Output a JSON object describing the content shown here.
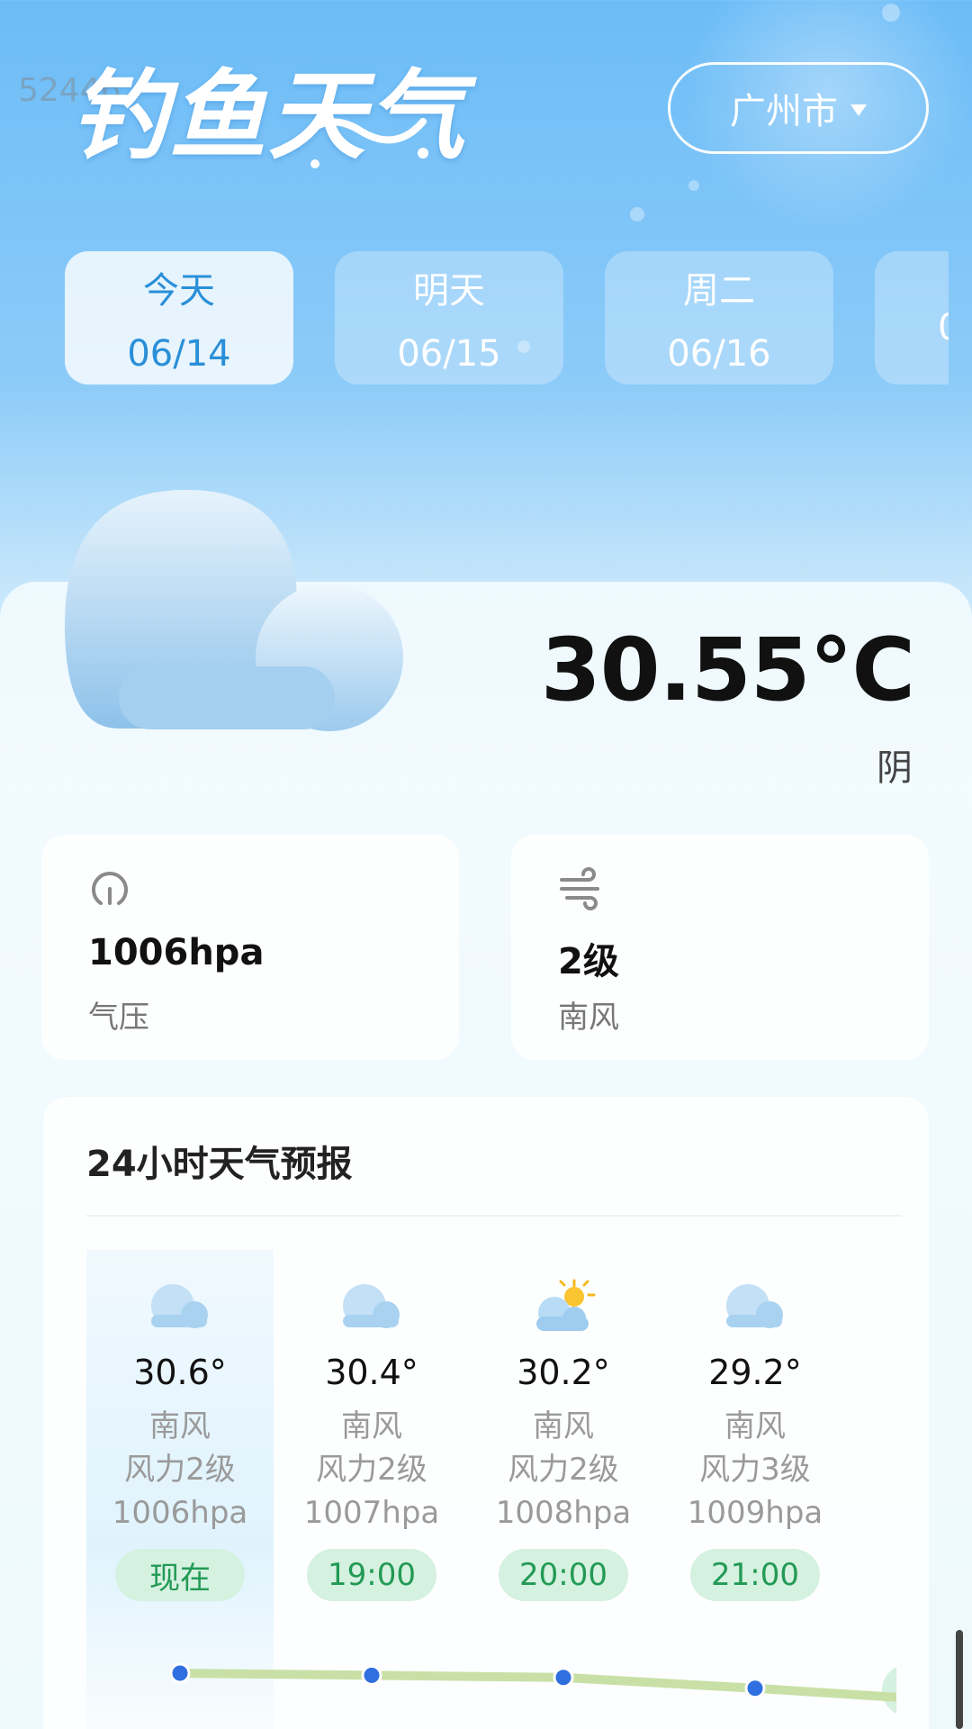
{
  "header": {
    "logo_text": "钓鱼天气",
    "watermark": "52446",
    "city": "广州市"
  },
  "date_tabs": [
    {
      "day": "今天",
      "date": "06/14",
      "active": true
    },
    {
      "day": "明天",
      "date": "06/15",
      "active": false
    },
    {
      "day": "周二",
      "date": "06/16",
      "active": false
    },
    {
      "day": "",
      "date": "0",
      "active": false
    }
  ],
  "current": {
    "temperature": "30.55°C",
    "condition": "阴",
    "icon": "cloud-icon"
  },
  "stats": {
    "pressure": {
      "value": "1006hpa",
      "label": "气压",
      "icon": "pressure-gauge-icon"
    },
    "wind": {
      "value": "2级",
      "label": "南风",
      "icon": "wind-icon"
    }
  },
  "forecast": {
    "title": "24小时天气预报",
    "hours": [
      {
        "temp": "30.6°",
        "wind": "南风",
        "level": "风力2级",
        "pressure": "1006hpa",
        "time": "现在",
        "icon": "cloud-icon",
        "temp_value": 30.6
      },
      {
        "temp": "30.4°",
        "wind": "南风",
        "level": "风力2级",
        "pressure": "1007hpa",
        "time": "19:00",
        "icon": "cloud-icon",
        "temp_value": 30.4
      },
      {
        "temp": "30.2°",
        "wind": "南风",
        "level": "风力2级",
        "pressure": "1008hpa",
        "time": "20:00",
        "icon": "partly-sunny-icon",
        "temp_value": 30.2
      },
      {
        "temp": "29.2°",
        "wind": "南风",
        "level": "风力3级",
        "pressure": "1009hpa",
        "time": "21:00",
        "icon": "cloud-icon",
        "temp_value": 29.2
      }
    ]
  },
  "colors": {
    "accent": "#2a8fd8",
    "time_pill_bg": "#d5f1e0",
    "time_pill_text": "#229a55",
    "curve_line": "#c8e0a6",
    "curve_dot": "#2f6fe0"
  }
}
